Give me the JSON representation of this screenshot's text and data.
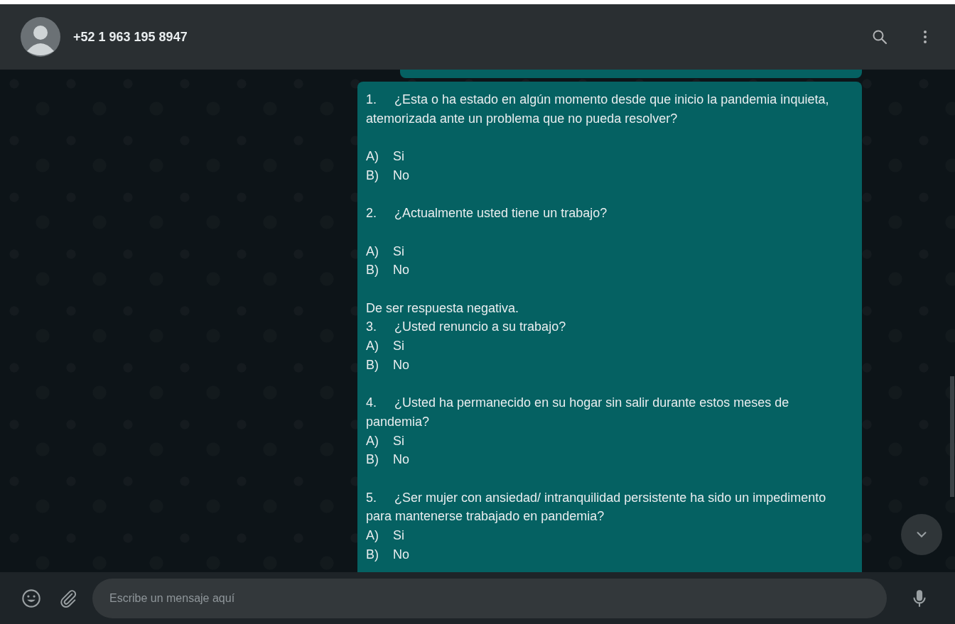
{
  "header": {
    "contact_name": "+52 1 963 195 8947"
  },
  "message": {
    "lines": [
      {
        "kind": "question",
        "text": "1.     ¿Esta o ha estado en algún momento desde que inicio la pandemia inquieta, atemorizada ante un problema que no pueda resolver?"
      },
      {
        "kind": "blank"
      },
      {
        "kind": "option",
        "text": "A)    Si"
      },
      {
        "kind": "option",
        "text": "B)    No"
      },
      {
        "kind": "blank"
      },
      {
        "kind": "question",
        "text": "2.     ¿Actualmente usted tiene un trabajo?"
      },
      {
        "kind": "blank"
      },
      {
        "kind": "option",
        "text": "A)    Si"
      },
      {
        "kind": "option",
        "text": "B)    No"
      },
      {
        "kind": "blank"
      },
      {
        "kind": "note",
        "text": "De ser respuesta negativa."
      },
      {
        "kind": "question",
        "text": "3.     ¿Usted renuncio a su trabajo?"
      },
      {
        "kind": "option",
        "text": "A)    Si"
      },
      {
        "kind": "option",
        "text": "B)    No"
      },
      {
        "kind": "blank"
      },
      {
        "kind": "question",
        "text": "4.     ¿Usted ha permanecido en su hogar sin salir durante estos meses de pandemia?"
      },
      {
        "kind": "option",
        "text": "A)    Si"
      },
      {
        "kind": "option",
        "text": "B)    No"
      },
      {
        "kind": "blank"
      },
      {
        "kind": "question",
        "text": "5.     ¿Ser mujer con ansiedad/ intranquilidad persistente ha sido un impedimento para mantenerse trabajado en pandemia?"
      },
      {
        "kind": "option",
        "text": "A)    Si"
      },
      {
        "kind": "option",
        "text": "B)    No"
      }
    ]
  },
  "composer": {
    "placeholder": "Escribe un mensaje aquí"
  }
}
